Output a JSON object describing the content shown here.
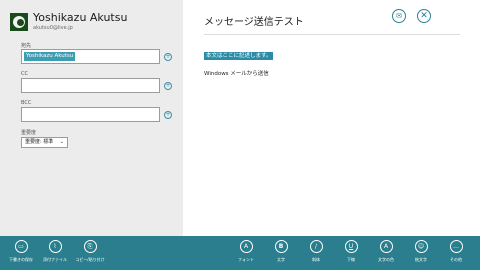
{
  "account": {
    "name": "Yoshikazu Akutsu",
    "email": "akutsu0@live.jp"
  },
  "to": {
    "label": "宛先",
    "recipient": "Yoshikazu Akutsu"
  },
  "cc": {
    "label": "CC"
  },
  "bcc": {
    "label": "BCC"
  },
  "importance": {
    "label": "重要度",
    "selected": "重要度: 標準"
  },
  "message": {
    "subject": "メッセージ送信テスト",
    "body_selected": "本文はここに記述します。",
    "signature": "Windows メールから送信"
  },
  "appbar": {
    "left": [
      {
        "label": "下書きの保存",
        "icon": "save-icon",
        "glyph": "▭"
      },
      {
        "label": "添付ファイル",
        "icon": "paperclip-icon",
        "glyph": "⌇"
      },
      {
        "label": "コピー/貼り付け",
        "icon": "paste-icon",
        "glyph": "⎘"
      }
    ],
    "right": [
      {
        "label": "フォント",
        "icon": "font-icon",
        "glyph": "A"
      },
      {
        "label": "太字",
        "icon": "bold-icon",
        "glyph": "B"
      },
      {
        "label": "斜体",
        "icon": "italic-icon",
        "glyph": "/"
      },
      {
        "label": "下線",
        "icon": "underline-icon",
        "glyph": "U"
      },
      {
        "label": "文字の色",
        "icon": "text-color-icon",
        "glyph": "A"
      },
      {
        "label": "絵文字",
        "icon": "emoji-icon",
        "glyph": "☺"
      },
      {
        "label": "その他",
        "icon": "more-icon",
        "glyph": "…"
      }
    ]
  },
  "colors": {
    "accent": "#2b7e8d",
    "selection": "#2a8ca6",
    "left_pane": "#ececec"
  }
}
